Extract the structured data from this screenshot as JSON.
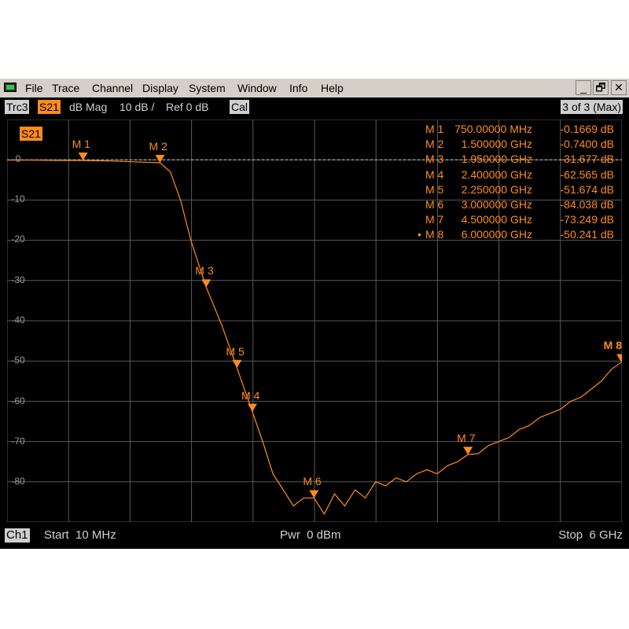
{
  "menubar": {
    "items": [
      "File",
      "Trace",
      "Channel",
      "Display",
      "System",
      "Window",
      "Info",
      "Help"
    ],
    "window_buttons": [
      "_",
      "🗗",
      "✕"
    ]
  },
  "tracebar": {
    "trace": "Trc3",
    "parameter": "S21",
    "format": "dB Mag",
    "scale": "10 dB /",
    "ref": "Ref 0 dB",
    "cal": "Cal",
    "trace_count": "3 of 3 (Max)"
  },
  "plot": {
    "trace_label": "S21",
    "yticks": [
      "0",
      "-10",
      "-20",
      "-30",
      "-40",
      "-50",
      "-60",
      "-70",
      "-80"
    ],
    "colors": {
      "trace": "#ff8c1a",
      "grid": "#5a5a5a",
      "background": "#000000",
      "ref_line": "#c8c8c8"
    }
  },
  "markers": [
    {
      "name": "M 1",
      "freq": "750.00000 MHz",
      "value": "-0.1669 dB",
      "f_ghz": 0.75,
      "db": -0.1669,
      "active": false
    },
    {
      "name": "M 2",
      "freq": "1.500000 GHz",
      "value": "-0.7400 dB",
      "f_ghz": 1.5,
      "db": -0.74,
      "active": false
    },
    {
      "name": "M 3",
      "freq": "1.950000 GHz",
      "value": "-31.677 dB",
      "f_ghz": 1.95,
      "db": -31.677,
      "active": false
    },
    {
      "name": "M 4",
      "freq": "2.400000 GHz",
      "value": "-62.565 dB",
      "f_ghz": 2.4,
      "db": -62.565,
      "active": false
    },
    {
      "name": "M 5",
      "freq": "2.250000 GHz",
      "value": "-51.674 dB",
      "f_ghz": 2.25,
      "db": -51.674,
      "active": false
    },
    {
      "name": "M 6",
      "freq": "3.000000 GHz",
      "value": "-84.038 dB",
      "f_ghz": 3.0,
      "db": -84.038,
      "active": false
    },
    {
      "name": "M 7",
      "freq": "4.500000 GHz",
      "value": "-73.249 dB",
      "f_ghz": 4.5,
      "db": -73.249,
      "active": false
    },
    {
      "name": "M 8",
      "freq": "6.000000 GHz",
      "value": "-50.241 dB",
      "f_ghz": 6.0,
      "db": -50.241,
      "active": true
    }
  ],
  "status": {
    "channel": "Ch1",
    "start": "Start  10 MHz",
    "power": "Pwr  0 dBm",
    "stop": "Stop  6 GHz"
  },
  "chart_data": {
    "type": "line",
    "xlabel": "",
    "ylabel": "",
    "xlim": [
      0.01,
      6.0
    ],
    "ylim": [
      -90,
      10
    ],
    "grid": true,
    "series": [
      {
        "name": "S21",
        "x": [
          0.01,
          0.25,
          0.5,
          0.75,
          1.0,
          1.25,
          1.5,
          1.6,
          1.7,
          1.8,
          1.95,
          2.1,
          2.25,
          2.4,
          2.5,
          2.6,
          2.7,
          2.8,
          2.9,
          3.0,
          3.1,
          3.2,
          3.3,
          3.4,
          3.5,
          3.6,
          3.7,
          3.8,
          3.9,
          4.0,
          4.1,
          4.2,
          4.3,
          4.4,
          4.5,
          4.6,
          4.7,
          4.8,
          4.9,
          5.0,
          5.1,
          5.2,
          5.3,
          5.4,
          5.5,
          5.6,
          5.7,
          5.8,
          5.9,
          6.0
        ],
        "y": [
          -0.1,
          -0.1,
          -0.15,
          -0.17,
          -0.3,
          -0.5,
          -0.74,
          -3,
          -10,
          -20,
          -31.7,
          -41,
          -51.7,
          -62.6,
          -70,
          -78,
          -82,
          -86,
          -84,
          -84,
          -88,
          -83,
          -86,
          -82,
          -84,
          -80,
          -81,
          -79,
          -80,
          -78,
          -77,
          -78,
          -76,
          -75,
          -73.2,
          -73,
          -71,
          -70,
          -69,
          -67,
          -66,
          -64,
          -63,
          -62,
          -60,
          -59,
          -57,
          -55,
          -52,
          -50.2
        ]
      }
    ]
  }
}
